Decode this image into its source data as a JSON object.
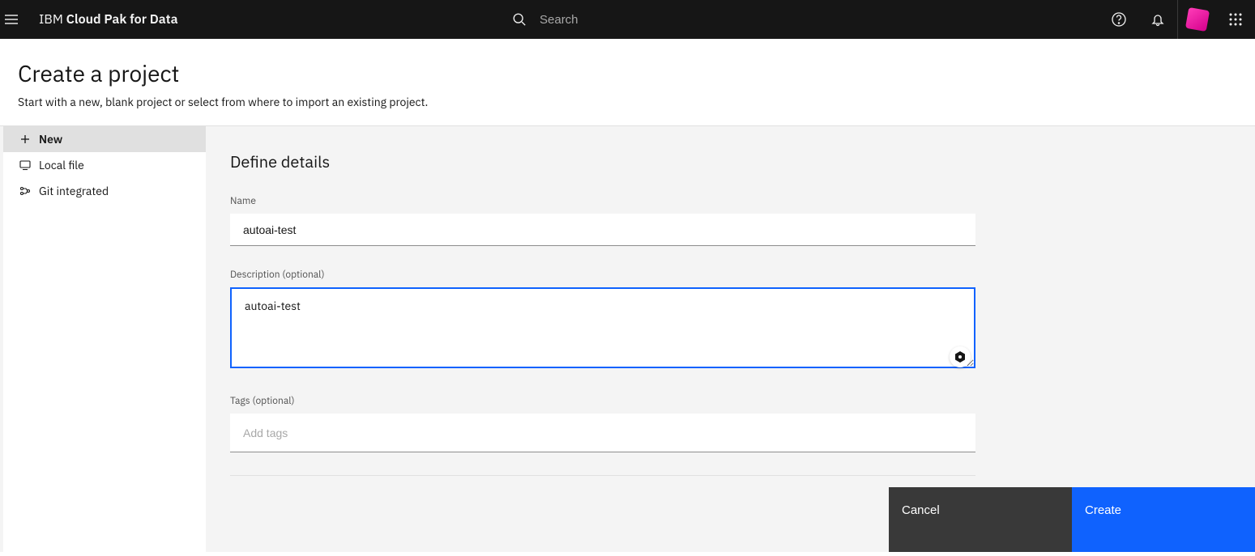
{
  "header": {
    "brand_prefix": "IBM ",
    "brand_bold": "Cloud Pak for Data",
    "search_placeholder": "Search"
  },
  "page": {
    "title": "Create a project",
    "subtitle": "Start with a new, blank project or select from where to import an existing project."
  },
  "sidebar": {
    "items": [
      {
        "label": "New"
      },
      {
        "label": "Local file"
      },
      {
        "label": "Git integrated"
      }
    ]
  },
  "form": {
    "heading": "Define details",
    "name_label": "Name",
    "name_value": "autoai-test",
    "desc_label": "Description (optional)",
    "desc_value": "autoai-test",
    "tags_label": "Tags (optional)",
    "tags_placeholder": "Add tags"
  },
  "buttons": {
    "cancel": "Cancel",
    "create": "Create"
  }
}
